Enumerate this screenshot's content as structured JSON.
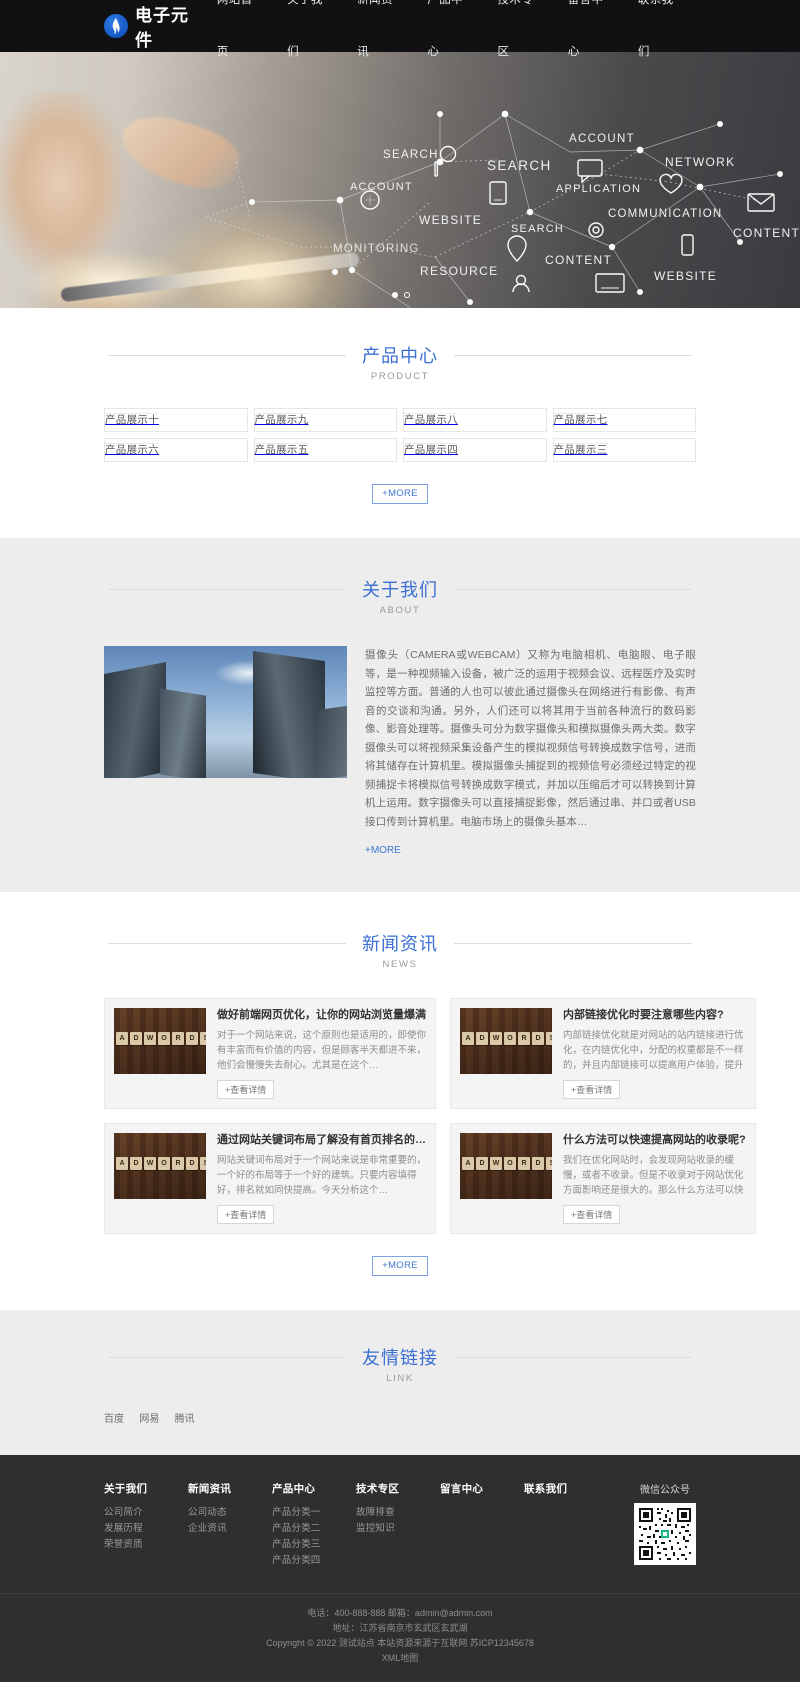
{
  "site": {
    "logo_text": "电子元件",
    "nav": [
      {
        "label": "网站首页"
      },
      {
        "label": "关于我们"
      },
      {
        "label": "新闻资讯"
      },
      {
        "label": "产品中心"
      },
      {
        "label": "技术专区"
      },
      {
        "label": "留言中心"
      },
      {
        "label": "联系我们"
      }
    ]
  },
  "banner": {
    "labels": [
      "SEARCH",
      "ACCOUNT",
      "SEARCH",
      "ACCOUNT",
      "NETWORK",
      "APPLICATION",
      "WEBSITE",
      "COMMUNICATION",
      "SEARCH",
      "CONTENT",
      "MONITORING",
      "RESOURCE",
      "CONTENT",
      "WEBSITE"
    ],
    "slide_active": 1,
    "slide_count": 2
  },
  "products": {
    "title_cn": "产品中心",
    "title_en": "PRODUCT",
    "items": [
      {
        "name": "产品展示十"
      },
      {
        "name": "产品展示九"
      },
      {
        "name": "产品展示八"
      },
      {
        "name": "产品展示七"
      },
      {
        "name": "产品展示六"
      },
      {
        "name": "产品展示五"
      },
      {
        "name": "产品展示四"
      },
      {
        "name": "产品展示三"
      }
    ],
    "more_label": "+MORE"
  },
  "about": {
    "title_cn": "关于我们",
    "title_en": "ABOUT",
    "body": "摄像头（CAMERA或WEBCAM）又称为电脑相机、电脑眼、电子眼等，是一种视频输入设备，被广泛的运用于视频会议、远程医疗及实时监控等方面。普通的人也可以彼此通过摄像头在网络进行有影像、有声音的交谈和沟通。另外，人们还可以将其用于当前各种流行的数码影像、影音处理等。摄像头可分为数字摄像头和模拟摄像头两大类。数字摄像头可以将视频采集设备产生的模拟视频信号转换成数字信号，进而将其储存在计算机里。模拟摄像头捕捉到的视频信号必须经过特定的视频捕捉卡将模拟信号转换成数字模式，并加以压缩后才可以转换到计算机上运用。数字摄像头可以直接捕捉影像，然后通过串、并口或者USB接口传到计算机里。电脑市场上的摄像头基本…",
    "more_label": "+MORE"
  },
  "news": {
    "title_cn": "新闻资讯",
    "title_en": "NEWS",
    "more_label": "+MORE",
    "read_label": "+查看详情",
    "thumb_letters": [
      "A",
      "D",
      "W",
      "O",
      "R",
      "D",
      "S"
    ],
    "items": [
      {
        "title": "做好前端网页优化，让你的网站浏览量爆满",
        "desc": "对于一个网站来说，这个原则也是适用的，即使你有丰富而有价值的内容，但是顾客半天都进不来，他们会慢慢失去耐心。尤其是在这个…"
      },
      {
        "title": "内部链接优化时要注意哪些内容?",
        "desc": "内部链接优化就是对网站的站内链接进行优化，在内链优化中，分配的权重都是不一样的，并且内部链接可以提高用户体验，提升访问…"
      },
      {
        "title": "通过网站关键词布局了解没有首页排名的…",
        "desc": "网站关键词布局对于一个网站来说是非常重要的，一个好的布局等于一个好的建筑。只要内容填得好，排名就如同快提高。今天分析这个…"
      },
      {
        "title": "什么方法可以快速提高网站的收录呢?",
        "desc": "我们在优化网站时，会发现网站收录的缓慢，或者不收录。但是不收录对于网站优化方面影响还是很大的。那么什么方法可以快速提高网…"
      }
    ]
  },
  "links": {
    "title_cn": "友情链接",
    "title_en": "LINK",
    "items": [
      {
        "label": "百度"
      },
      {
        "label": "网易"
      },
      {
        "label": "腾讯"
      }
    ]
  },
  "footer": {
    "columns": [
      {
        "heading": "关于我们",
        "links": [
          {
            "label": "公司简介"
          },
          {
            "label": "发展历程"
          },
          {
            "label": "荣誉资质"
          }
        ]
      },
      {
        "heading": "新闻资讯",
        "links": [
          {
            "label": "公司动态"
          },
          {
            "label": "企业资讯"
          }
        ]
      },
      {
        "heading": "产品中心",
        "links": [
          {
            "label": "产品分类一"
          },
          {
            "label": "产品分类二"
          },
          {
            "label": "产品分类三"
          },
          {
            "label": "产品分类四"
          }
        ]
      },
      {
        "heading": "技术专区",
        "links": [
          {
            "label": "故障排查"
          },
          {
            "label": "监控知识"
          }
        ]
      },
      {
        "heading": "留言中心",
        "links": []
      },
      {
        "heading": "联系我们",
        "links": []
      }
    ],
    "qr_label": "微信公众号",
    "contact_line": "电话：400-888-888 邮箱：admin@admin.com",
    "address_line": "地址：江苏省南京市玄武区玄武湖",
    "copyright_line": "Copyright © 2022 测试站点 本站资源来源于互联网 苏ICP12345678",
    "sitemap_label": "XML地图"
  },
  "colors": {
    "accent": "#3b6fd4",
    "header_bg": "#111113",
    "footer_bg": "#2f2f31",
    "section_alt_bg": "#ededed"
  }
}
